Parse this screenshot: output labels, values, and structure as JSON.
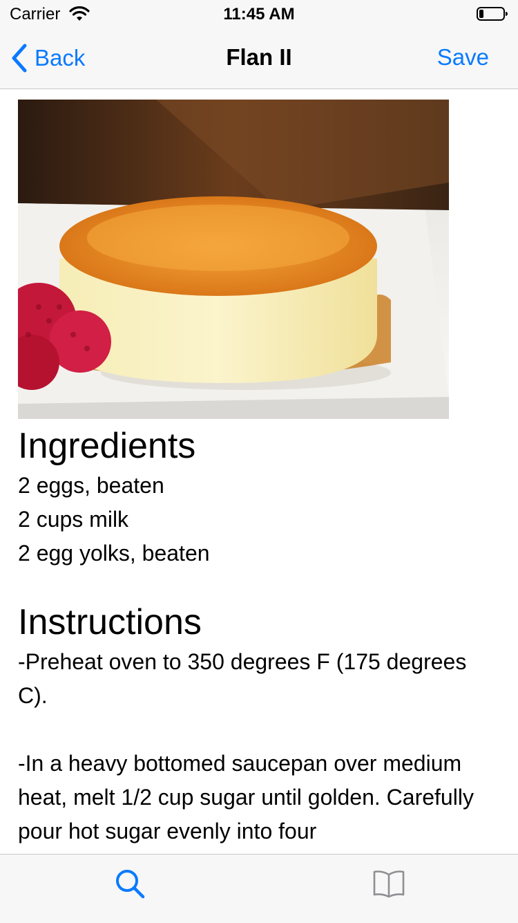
{
  "status_bar": {
    "carrier": "Carrier",
    "time": "11:45 AM"
  },
  "nav": {
    "back_label": "Back",
    "title": "Flan II",
    "save_label": "Save"
  },
  "recipe": {
    "ingredients_heading": "Ingredients",
    "ingredients": [
      "2 eggs, beaten",
      "2 cups milk",
      "2 egg yolks, beaten"
    ],
    "instructions_heading": "Instructions",
    "instructions": [
      "-Preheat oven to 350 degrees F (175 degrees C).",
      "-In a heavy bottomed saucepan over medium heat, melt 1/2 cup sugar until golden. Carefully pour hot sugar evenly into four"
    ]
  },
  "tab_bar": {
    "items": [
      {
        "icon": "search-icon",
        "selected": true
      },
      {
        "icon": "book-icon",
        "selected": false
      }
    ]
  },
  "colors": {
    "accent": "#0a7aff",
    "bar_background": "#f7f7f7",
    "inactive_icon": "#8e8e93"
  }
}
